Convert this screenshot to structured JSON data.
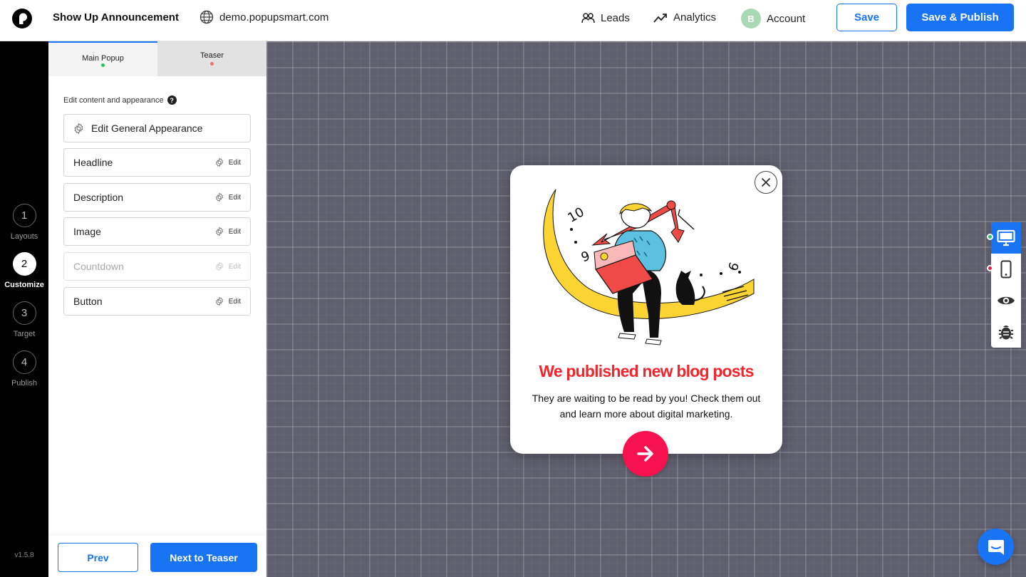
{
  "header": {
    "campaign_title": "Show Up Announcement",
    "site_domain": "demo.popupsmart.com",
    "nav": {
      "leads": "Leads",
      "analytics": "Analytics",
      "account_initial": "B",
      "account": "Account"
    },
    "save_label": "Save",
    "publish_label": "Save & Publish"
  },
  "steps": [
    {
      "number": "1",
      "label": "Layouts"
    },
    {
      "number": "2",
      "label": "Customize"
    },
    {
      "number": "3",
      "label": "Target"
    },
    {
      "number": "4",
      "label": "Publish"
    }
  ],
  "version": "v1.5.8",
  "panel": {
    "tabs": [
      {
        "label": "Main Popup",
        "dot_color": "#22c55e"
      },
      {
        "label": "Teaser",
        "dot_color": "#f07070"
      }
    ],
    "section_label": "Edit content and appearance",
    "help_glyph": "?",
    "general_appearance": "Edit General Appearance",
    "edit_label": "Edit",
    "rows": [
      {
        "label": "Headline"
      },
      {
        "label": "Description"
      },
      {
        "label": "Image"
      },
      {
        "label": "Countdown"
      },
      {
        "label": "Button"
      }
    ],
    "prev_label": "Prev",
    "next_label": "Next to Teaser"
  },
  "popup": {
    "headline": "We published new blog posts",
    "description": "They are waiting to be read by you! Check them out and learn more about digital marketing.",
    "clock_numbers": [
      "10",
      "9",
      "6"
    ],
    "headline_color": "#f4262d",
    "cta_color": "#f6124e"
  },
  "device_status": {
    "desktop_dot": "#22c55e",
    "mobile_dot": "#e11d48"
  },
  "colors": {
    "primary": "#1874f3"
  }
}
